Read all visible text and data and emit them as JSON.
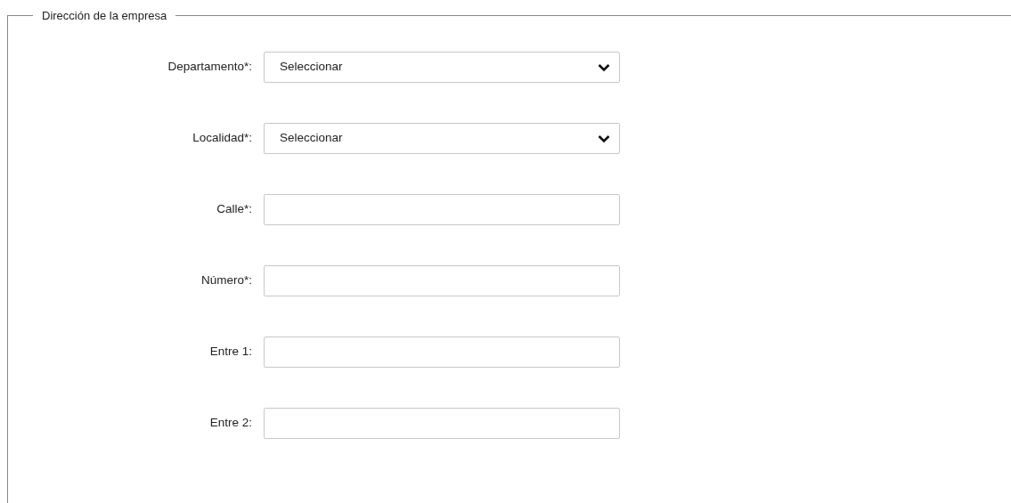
{
  "section": {
    "legend": "Dirección de la empresa"
  },
  "fields": [
    {
      "kind": "select",
      "label": "Departamento*:",
      "value": "Seleccionar"
    },
    {
      "kind": "select",
      "label": "Localidad*:",
      "value": "Seleccionar"
    },
    {
      "kind": "text",
      "label": "Calle*:"
    },
    {
      "kind": "text",
      "label": "Número*:"
    },
    {
      "kind": "text",
      "label": "Entre 1:"
    },
    {
      "kind": "text",
      "label": "Entre 2:"
    }
  ]
}
